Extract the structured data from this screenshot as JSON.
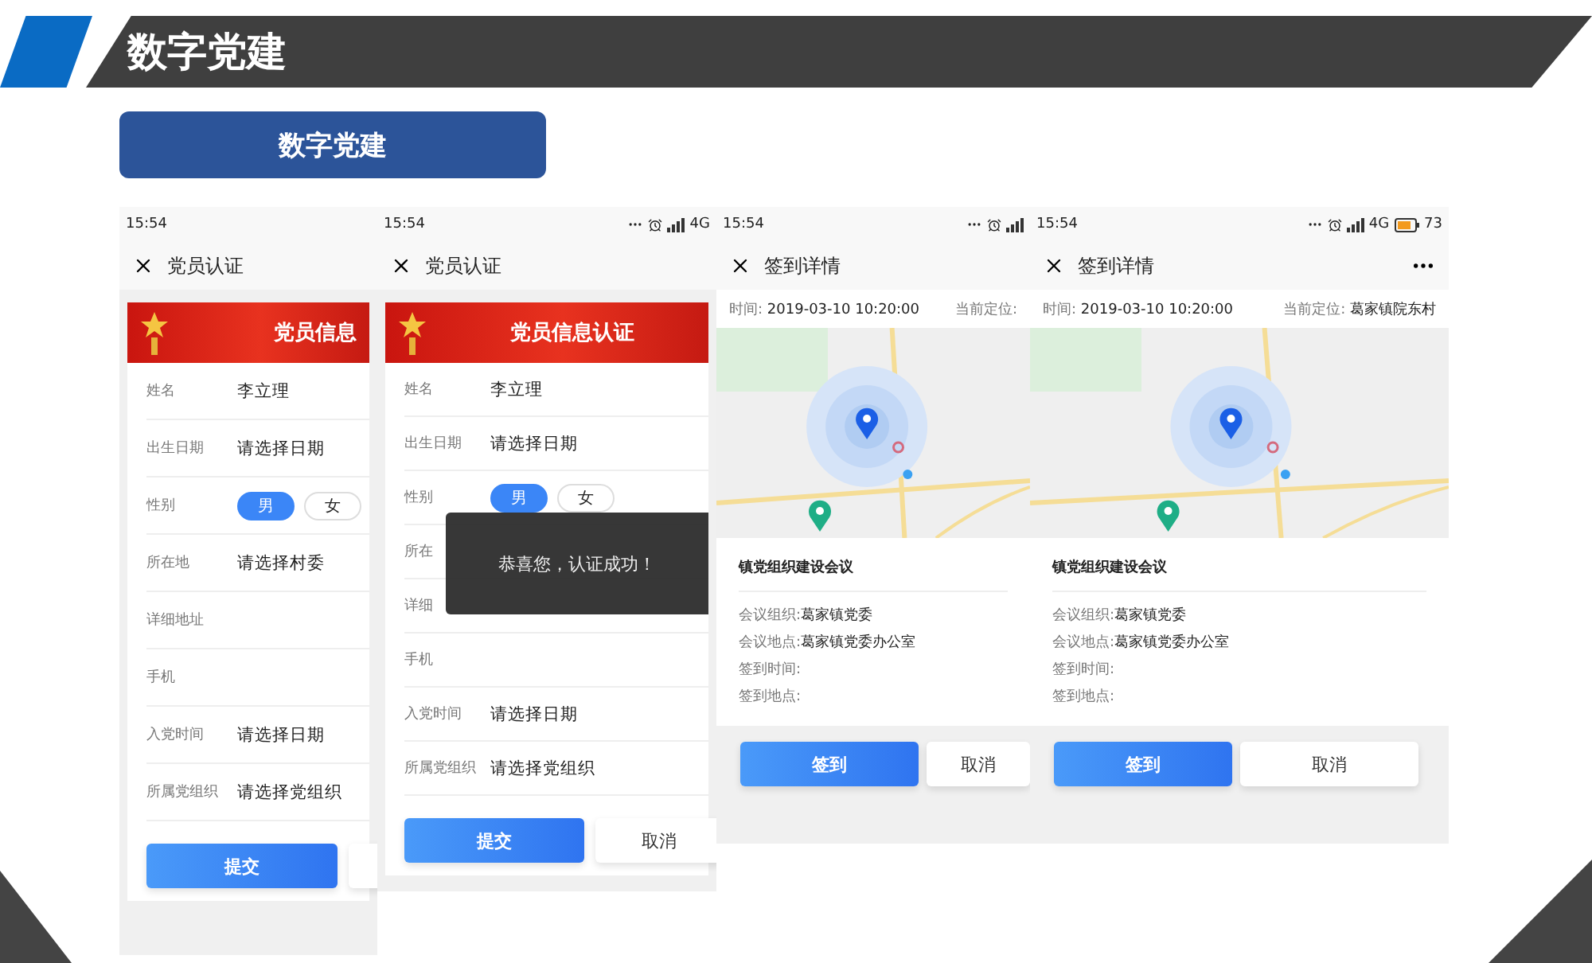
{
  "header": {
    "title": "数字党建"
  },
  "subtitle": "数字党建",
  "phones": [
    {
      "kind": "form",
      "status": {
        "time": "15:54"
      },
      "title": "党员认证",
      "banner": "党员信息",
      "fields": [
        {
          "kind": "text",
          "label": "姓名",
          "value": "李立理"
        },
        {
          "kind": "text",
          "label": "出生日期",
          "value": "请选择日期"
        },
        {
          "kind": "gender",
          "label": "性别",
          "options": [
            {
              "label": "男",
              "selected": true
            },
            {
              "label": "女",
              "selected": false
            }
          ]
        },
        {
          "kind": "text",
          "label": "所在地",
          "value": "请选择村委"
        },
        {
          "kind": "text",
          "label": "详细地址"
        },
        {
          "kind": "text",
          "label": "手机"
        },
        {
          "kind": "text",
          "label": "入党时间",
          "value": "请选择日期"
        },
        {
          "kind": "text",
          "label": "所属党组织",
          "value": "请选择党组织"
        }
      ],
      "buttons": [
        {
          "kind": "primary",
          "label": "提交"
        },
        {
          "kind": "secondary"
        }
      ]
    },
    {
      "kind": "form",
      "status": {
        "time": "15:54",
        "icons": true,
        "network": "4G"
      },
      "title": "党员认证",
      "banner": "党员信息认证",
      "fields": [
        {
          "kind": "text",
          "label": "姓名",
          "value": "李立理"
        },
        {
          "kind": "text",
          "label": "出生日期",
          "value": "请选择日期"
        },
        {
          "kind": "gender",
          "label": "性别",
          "options": [
            {
              "label": "男",
              "selected": true
            },
            {
              "label": "女",
              "selected": false
            }
          ]
        },
        {
          "kind": "text",
          "label": "所在"
        },
        {
          "kind": "text",
          "label": "详细"
        },
        {
          "kind": "text",
          "label": "手机"
        },
        {
          "kind": "text",
          "label": "入党时间",
          "value": "请选择日期"
        },
        {
          "kind": "text",
          "label": "所属党组织",
          "value": "请选择党组织"
        }
      ],
      "toast": "恭喜您，认证成功！",
      "buttons": [
        {
          "kind": "primary",
          "label": "提交"
        },
        {
          "kind": "secondary",
          "label": "取消"
        }
      ]
    },
    {
      "kind": "detail",
      "status": {
        "time": "15:54",
        "icons": true
      },
      "title": "签到详情",
      "time_label": "时间:",
      "time_value": "2019-03-10 10:20:00",
      "location_label": "当前定位:",
      "meeting": "镇党组织建设会议",
      "rows": [
        {
          "label": "会议组织:",
          "value": "葛家镇党委"
        },
        {
          "label": "会议地点:",
          "value": "葛家镇党委办公室"
        },
        {
          "label": "签到时间:"
        },
        {
          "label": "签到地点:"
        }
      ],
      "buttons": [
        {
          "kind": "primary",
          "label": "签到"
        },
        {
          "kind": "secondary",
          "label": "取消"
        }
      ]
    },
    {
      "kind": "detail",
      "status": {
        "time": "15:54",
        "icons": true,
        "network": "4G",
        "battery": "73"
      },
      "more_menu": true,
      "title": "签到详情",
      "time_label": "时间:",
      "time_value": "2019-03-10 10:20:00",
      "location_label": "当前定位:",
      "location_value": "葛家镇院东村",
      "meeting": "镇党组织建设会议",
      "rows": [
        {
          "label": "会议组织:",
          "value": "葛家镇党委"
        },
        {
          "label": "会议地点:",
          "value": "葛家镇党委办公室"
        },
        {
          "label": "签到时间:"
        },
        {
          "label": "签到地点:"
        }
      ],
      "buttons": [
        {
          "kind": "primary",
          "label": "签到"
        },
        {
          "kind": "secondary",
          "label": "取消"
        }
      ]
    }
  ]
}
